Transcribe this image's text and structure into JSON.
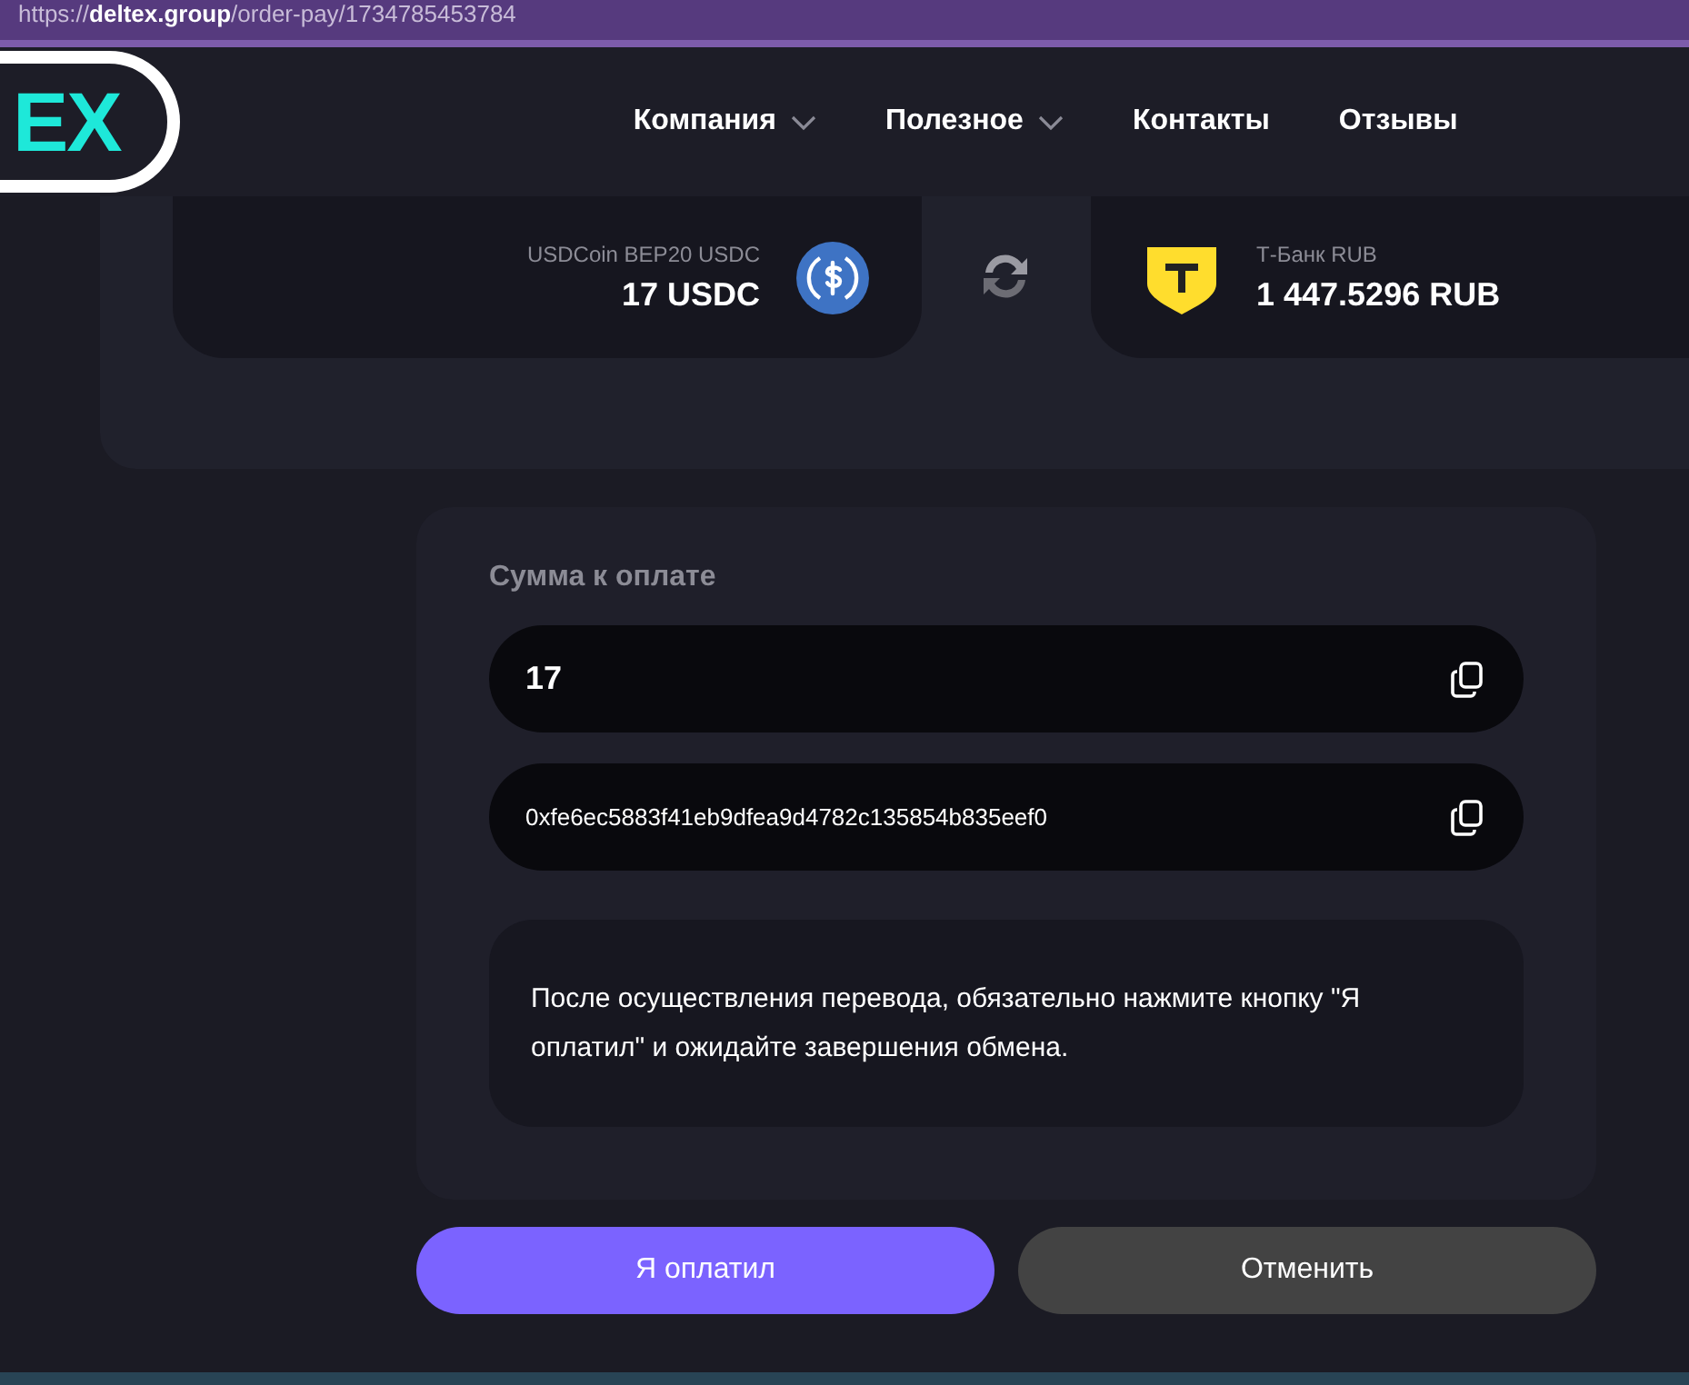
{
  "address_bar": {
    "url": "https://**deltex.group**/order-pay/1734785453784"
  },
  "header": {
    "logo": "EX",
    "nav": [
      {
        "label": "Компания",
        "dropdown": true
      },
      {
        "label": "Полезное",
        "dropdown": true
      },
      {
        "label": "Контакты",
        "dropdown": false
      },
      {
        "label": "Отзывы",
        "dropdown": false
      }
    ]
  },
  "exchange": {
    "from": {
      "name": "USDCoin BEP20 USDC",
      "amount": "17 USDC"
    },
    "to": {
      "name": "Т-Банк RUB",
      "amount": "1 447.5296 RUB"
    }
  },
  "payment": {
    "label": "Сумма к оплате",
    "fields": [
      {
        "kind": "amount",
        "value": "17"
      },
      {
        "kind": "address",
        "value": "0xfe6ec5883f41eb9dfea9d4782c135854b835eef0"
      }
    ],
    "notice": "После осуществления перевода, обязательно нажмите кнопку \"Я оплатил\" и ожидайте завершения обмена."
  },
  "buttons": [
    {
      "kind": "primary",
      "label": "Я оплатил"
    },
    {
      "kind": "secondary",
      "label": "Отменить"
    }
  ]
}
